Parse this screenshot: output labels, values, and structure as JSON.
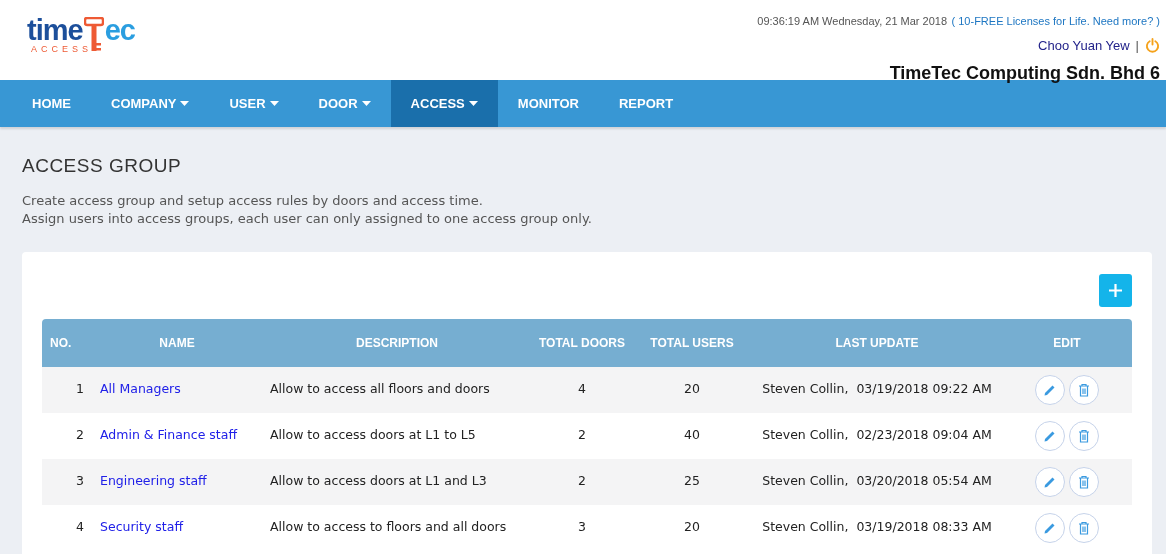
{
  "logo": {
    "word_start": "time",
    "word_end": "ec",
    "subtitle": "ACCESS"
  },
  "header": {
    "datetime": "09:36:19 AM Wednesday, 21 Mar 2018",
    "license_link": "( 10-FREE Licenses for Life. Need more? )",
    "user": "Choo Yuan Yew",
    "separator": "|",
    "company": "TimeTec Computing Sdn. Bhd 6"
  },
  "nav": [
    {
      "label": "HOME",
      "dropdown": false,
      "selected": false
    },
    {
      "label": "COMPANY",
      "dropdown": true,
      "selected": false
    },
    {
      "label": "USER",
      "dropdown": true,
      "selected": false
    },
    {
      "label": "DOOR",
      "dropdown": true,
      "selected": false
    },
    {
      "label": "ACCESS",
      "dropdown": true,
      "selected": true
    },
    {
      "label": "MONITOR",
      "dropdown": false,
      "selected": false
    },
    {
      "label": "REPORT",
      "dropdown": false,
      "selected": false
    }
  ],
  "page": {
    "title": "ACCESS GROUP",
    "description": [
      "Create access group and setup access rules by doors and access time.",
      "Assign users into access groups, each user can only assigned to one access group only."
    ]
  },
  "table": {
    "columns": [
      "NO.",
      "NAME",
      "DESCRIPTION",
      "TOTAL DOORS",
      "TOTAL USERS",
      "LAST UPDATE",
      "EDIT"
    ],
    "rows": [
      {
        "no": "1",
        "name": "All Managers",
        "description": "Allow to access all floors and doors",
        "total_doors": "4",
        "total_users": "20",
        "updated_by": "Steven Collin,",
        "updated_at": "03/19/2018 09:22 AM"
      },
      {
        "no": "2",
        "name": "Admin & Finance staff",
        "description": "Allow to access doors at L1 to L5",
        "total_doors": "2",
        "total_users": "40",
        "updated_by": "Steven Collin,",
        "updated_at": "02/23/2018 09:04 AM"
      },
      {
        "no": "3",
        "name": "Engineering staff",
        "description": "Allow to access doors at L1 and L3",
        "total_doors": "2",
        "total_users": "25",
        "updated_by": "Steven Collin,",
        "updated_at": "03/20/2018 05:54 AM"
      },
      {
        "no": "4",
        "name": "Security staff",
        "description": "Allow to access to floors and all doors",
        "total_doors": "3",
        "total_users": "20",
        "updated_by": "Steven Collin,",
        "updated_at": "03/19/2018 08:33 AM"
      }
    ]
  }
}
